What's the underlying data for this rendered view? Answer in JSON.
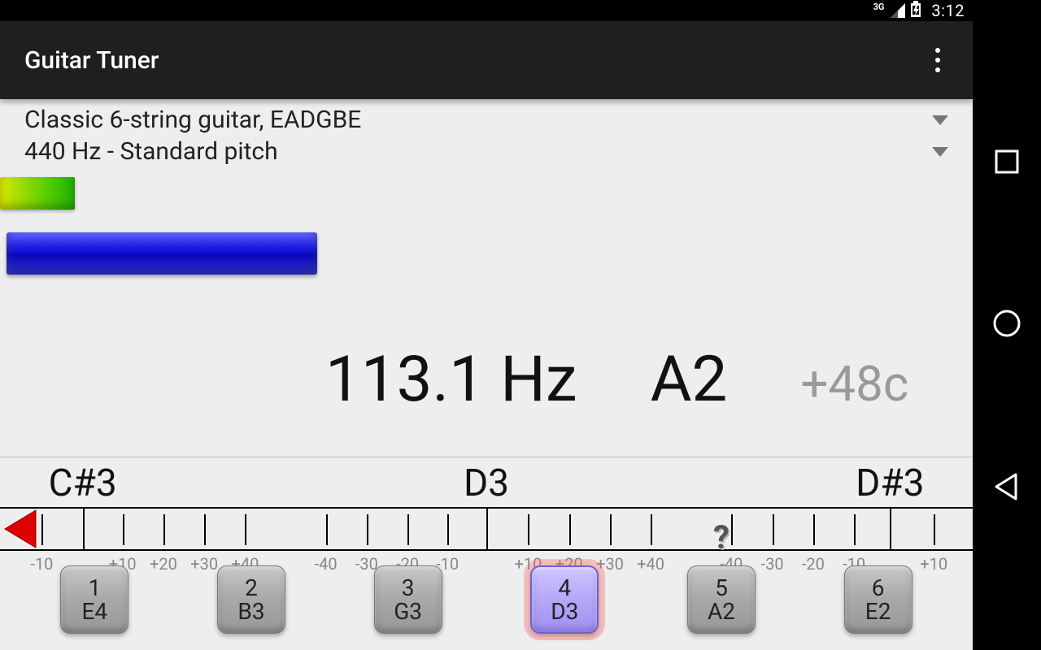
{
  "status_bar": {
    "network": "3G",
    "time": "3:12"
  },
  "action_bar": {
    "title": "Guitar Tuner"
  },
  "tuning_spinner": {
    "label": "Classic 6-string guitar, EADGBE"
  },
  "pitch_spinner": {
    "label": "440 Hz - Standard pitch"
  },
  "readout": {
    "frequency": "113.1 Hz",
    "note": "A2",
    "cents": "+48c"
  },
  "scale": {
    "notes": [
      {
        "label": "C#3",
        "pos_pct": 8.5
      },
      {
        "label": "D3",
        "pos_pct": 50.0
      },
      {
        "label": "D#3",
        "pos_pct": 91.5
      }
    ],
    "cent_labels": [
      {
        "label": "-10",
        "pos_pct": 4.3
      },
      {
        "label": "+10",
        "pos_pct": 12.6
      },
      {
        "label": "+20",
        "pos_pct": 16.8
      },
      {
        "label": "+30",
        "pos_pct": 21.0
      },
      {
        "label": "+40",
        "pos_pct": 25.2
      },
      {
        "label": "-40",
        "pos_pct": 33.5
      },
      {
        "label": "-30",
        "pos_pct": 37.7
      },
      {
        "label": "-20",
        "pos_pct": 41.9
      },
      {
        "label": "-10",
        "pos_pct": 46.0
      },
      {
        "label": "+10",
        "pos_pct": 54.3
      },
      {
        "label": "+20",
        "pos_pct": 58.5
      },
      {
        "label": "+30",
        "pos_pct": 62.7
      },
      {
        "label": "+40",
        "pos_pct": 66.9
      },
      {
        "label": "-40",
        "pos_pct": 75.2
      },
      {
        "label": "-30",
        "pos_pct": 79.4
      },
      {
        "label": "-20",
        "pos_pct": 83.6
      },
      {
        "label": "-10",
        "pos_pct": 87.8
      },
      {
        "label": "+10",
        "pos_pct": 96.0
      }
    ]
  },
  "strings": [
    {
      "num": "1",
      "note": "E4",
      "active": false,
      "hint": false
    },
    {
      "num": "2",
      "note": "B3",
      "active": false,
      "hint": false
    },
    {
      "num": "3",
      "note": "G3",
      "active": false,
      "hint": false
    },
    {
      "num": "4",
      "note": "D3",
      "active": true,
      "hint": false
    },
    {
      "num": "5",
      "note": "A2",
      "active": false,
      "hint": true
    },
    {
      "num": "6",
      "note": "E2",
      "active": false,
      "hint": false
    }
  ]
}
